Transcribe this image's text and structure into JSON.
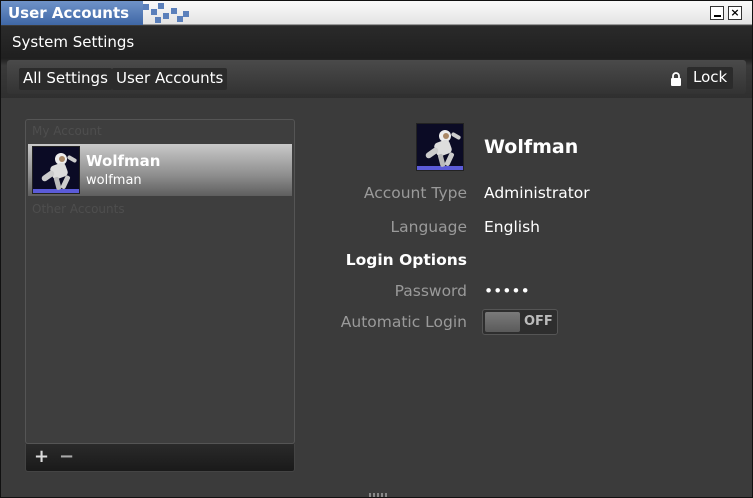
{
  "window": {
    "title": "User Accounts"
  },
  "header": {
    "title": "System Settings",
    "breadcrumbs": [
      "All Settings",
      "User Accounts"
    ],
    "lock_label": "Lock"
  },
  "accounts": {
    "my_account_label": "My Account",
    "other_accounts_label": "Other Accounts",
    "selected": {
      "name": "Wolfman",
      "login": "wolfman"
    },
    "add_label": "+",
    "remove_label": "−"
  },
  "details": {
    "name": "Wolfman",
    "account_type_label": "Account Type",
    "account_type_value": "Administrator",
    "language_label": "Language",
    "language_value": "English",
    "login_options_heading": "Login Options",
    "password_label": "Password",
    "password_value": "•••••",
    "auto_login_label": "Automatic Login",
    "auto_login_state": "OFF"
  },
  "icons": {
    "avatar": "astronaut-icon",
    "lock": "lock-icon"
  }
}
